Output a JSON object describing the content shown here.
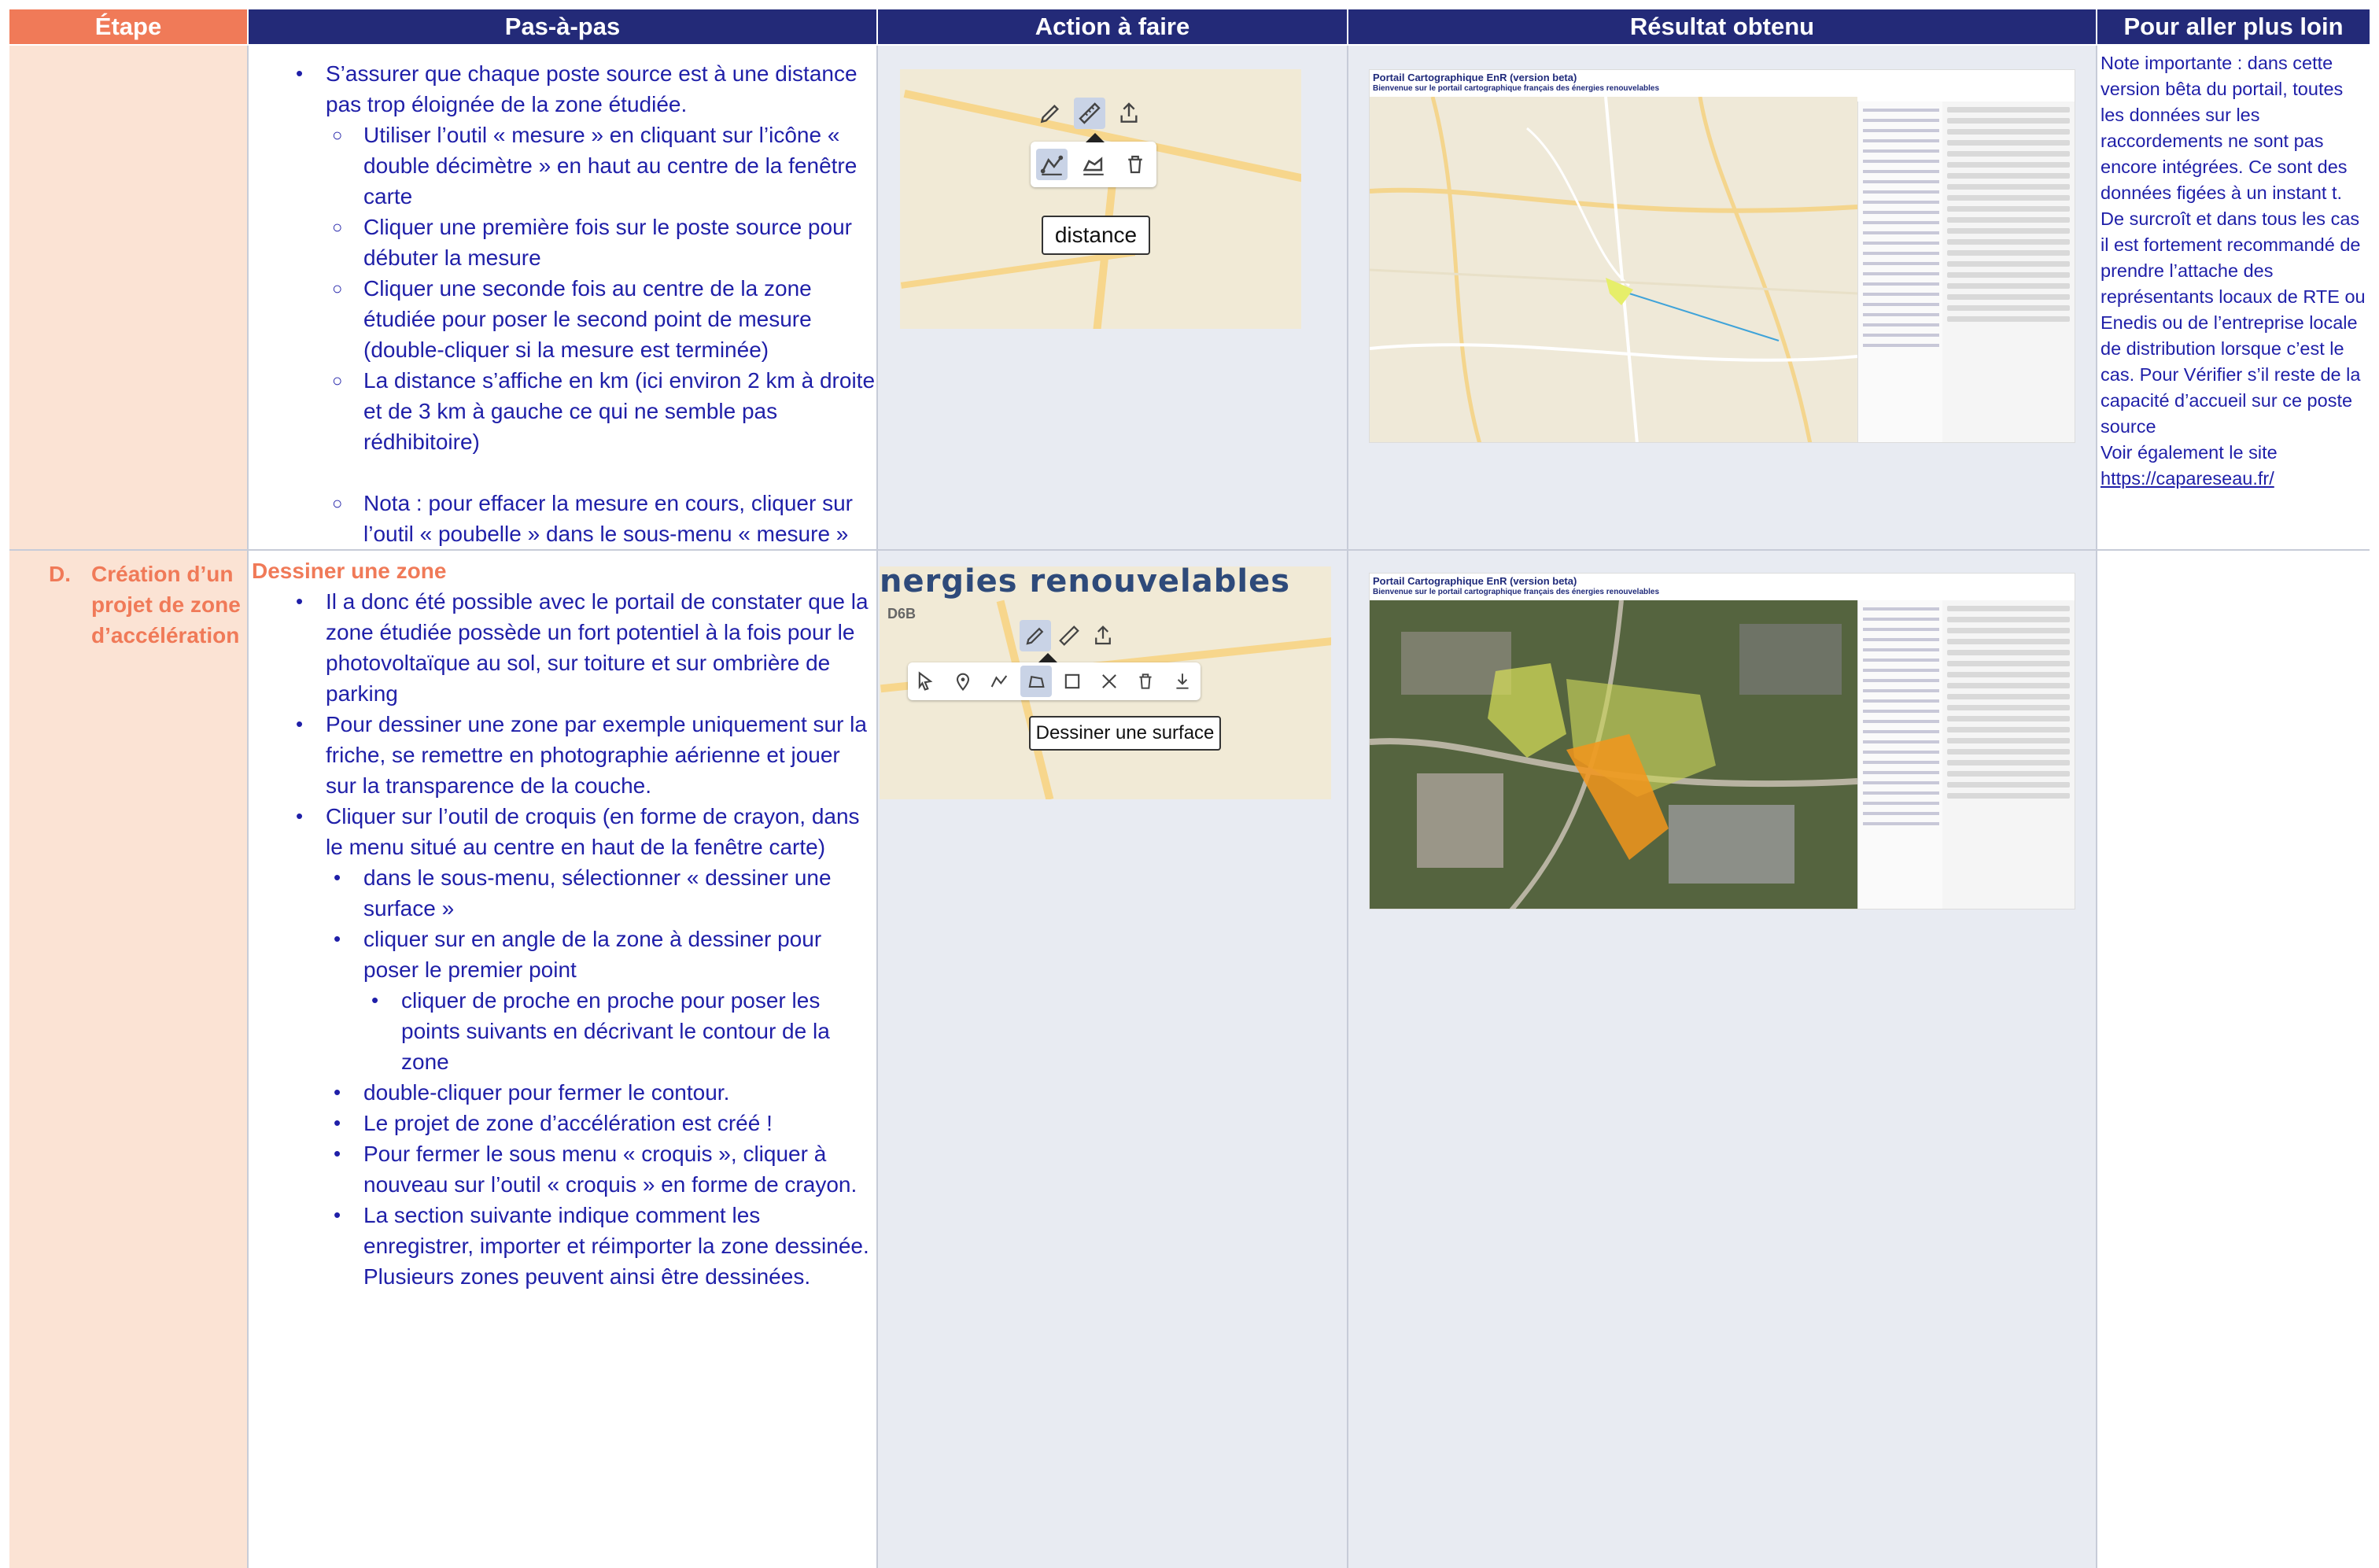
{
  "headers": {
    "etape": "Étape",
    "pas": "Pas-à-pas",
    "action": "Action à faire",
    "resultat": "Résultat obtenu",
    "plus": "Pour aller plus loin"
  },
  "row1": {
    "steps": [
      {
        "level": 1,
        "marker": "bullet",
        "text": "S’assurer que chaque poste source est à une distance pas trop éloignée de la zone étudiée."
      },
      {
        "level": 2,
        "marker": "circle",
        "text": "Utiliser l’outil « mesure » en cliquant sur l’icône « double décimètre » en haut au centre de la fenêtre carte"
      },
      {
        "level": 2,
        "marker": "circle",
        "text": "Cliquer une première fois sur le poste source pour débuter la mesure"
      },
      {
        "level": 2,
        "marker": "circle",
        "text": "Cliquer une seconde fois au centre de la zone étudiée pour poser le second point de mesure (double-cliquer si la mesure est terminée)"
      },
      {
        "level": 2,
        "marker": "circle",
        "text": "La distance s’affiche en km (ici environ 2 km à droite et de 3 km à gauche ce qui ne semble pas rédhibitoire)"
      },
      {
        "level": 2,
        "marker": "circle",
        "text": "Nota : pour effacer la mesure en cours, cliquer sur l’outil « poubelle » dans le sous-menu « mesure »"
      }
    ],
    "action_tooltip": "distance",
    "result": {
      "title": "Portail Cartographique EnR (version beta)",
      "subtitle": "Bienvenue sur le portail cartographique français des énergies renouvelables"
    },
    "plus_text": "Note importante : dans cette version bêta du portail, toutes les données sur les raccordements ne sont pas encore intégrées. Ce sont des données figées à un instant t. De surcroît et dans tous les cas il est fortement recommandé de prendre l’attache des représentants locaux de RTE ou Enedis ou de l’entreprise locale de distribution lorsque c’est le cas. Pour Vérifier s’il reste de la capacité d’accueil sur ce poste source",
    "plus_see": "Voir également le site",
    "plus_link": "https://capareseau.fr/"
  },
  "row2": {
    "etape_letter": "D.",
    "etape_label": "Création d’un projet de zone d’accélération",
    "section_title": "Dessiner une zone",
    "steps": [
      {
        "level": 1,
        "marker": "bullet",
        "text": "Il a donc été possible avec le portail de constater que la zone étudiée possède un fort potentiel à la fois pour le photovoltaïque au sol, sur toiture et sur ombrière de parking"
      },
      {
        "level": 1,
        "marker": "bullet",
        "text": "Pour dessiner une zone par exemple uniquement sur la friche, se remettre en photographie aérienne et jouer sur la transparence de la couche."
      },
      {
        "level": 1,
        "marker": "bullet",
        "text": "Cliquer sur l’outil de croquis (en forme de crayon, dans le menu situé au centre en haut de la fenêtre carte)"
      },
      {
        "level": 2,
        "marker": "dot",
        "text": "dans le sous-menu, sélectionner « dessiner une surface »"
      },
      {
        "level": 2,
        "marker": "dot",
        "text": "cliquer sur en angle de la zone à dessiner pour poser le premier point"
      },
      {
        "level": 3,
        "marker": "dot",
        "text": "cliquer de proche en proche pour poser les points suivants en décrivant le contour de la zone"
      },
      {
        "level": 2,
        "marker": "dot",
        "text": "double-cliquer pour fermer le contour."
      },
      {
        "level": 2,
        "marker": "dot",
        "text": "Le projet de zone d’accélération est créé !"
      },
      {
        "level": 2,
        "marker": "dot",
        "text": "Pour fermer le sous menu « croquis », cliquer à nouveau sur l’outil « croquis » en forme de crayon."
      },
      {
        "level": 2,
        "marker": "dot",
        "text": "La section suivante indique comment les enregistrer, importer et réimporter la zone dessinée. Plusieurs zones peuvent ainsi être dessinées."
      }
    ],
    "action_banner": "nergies renouvelables",
    "action_road": "D6B",
    "action_tooltip": "Dessiner une surface",
    "result": {
      "title": "Portail Cartographique EnR (version beta)",
      "subtitle": "Bienvenue sur le portail cartographique français des énergies renouvelables"
    }
  },
  "colors": {
    "header_blue": "#232a78",
    "header_orange": "#f07a58",
    "etape_bg": "#fbe3d4",
    "text_blue": "#1f1fa8"
  }
}
